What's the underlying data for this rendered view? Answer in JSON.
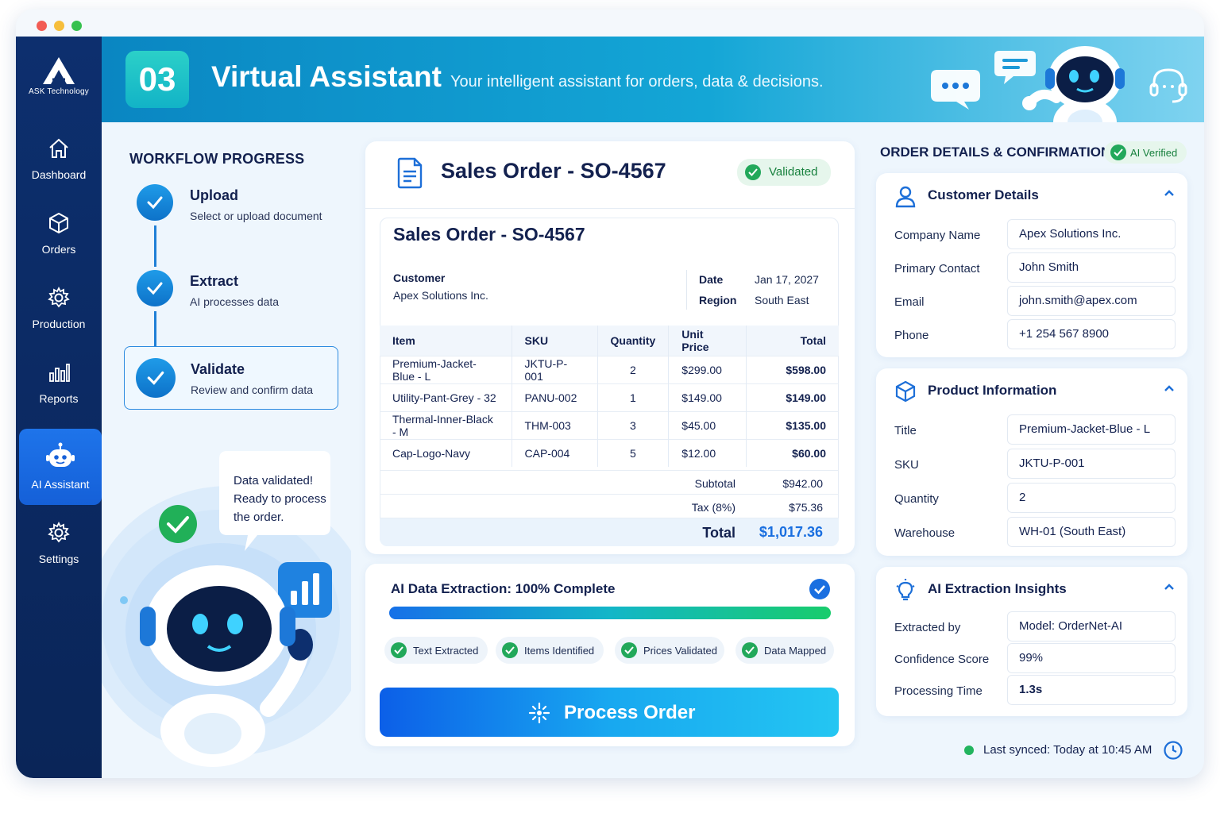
{
  "app": {
    "logo_text": "ASK Technology",
    "step_number": "03",
    "title": "Virtual Assistant",
    "subtitle": "Your intelligent assistant for orders, data & decisions."
  },
  "colors": {
    "primary": "#1560d8",
    "sidebar": "#0d2f6e",
    "success": "#22a85a",
    "accent": "#14a6d6"
  },
  "sidebar": {
    "items": [
      {
        "label": "Dashboard",
        "icon": "home-icon"
      },
      {
        "label": "Orders",
        "icon": "box-icon"
      },
      {
        "label": "Production",
        "icon": "gear-icon"
      },
      {
        "label": "Reports",
        "icon": "bar-chart-icon"
      },
      {
        "label": "AI Assistant",
        "icon": "robot-icon",
        "active": true
      },
      {
        "label": "Settings",
        "icon": "gear-icon"
      }
    ]
  },
  "workflow": {
    "title": "WORKFLOW PROGRESS",
    "steps": [
      {
        "title": "Upload",
        "subtitle": "Select or upload document"
      },
      {
        "title": "Extract",
        "subtitle": "AI processes data"
      },
      {
        "title": "Validate",
        "subtitle": "Review and confirm data"
      }
    ],
    "bubble": {
      "line1": "Data validated!",
      "line2": "Ready to process",
      "line3": "the order."
    }
  },
  "order": {
    "header_title": "Sales Order - SO-4567",
    "status": "Validated",
    "doc_title": "Sales Order - SO-4567",
    "customer_label": "Customer",
    "customer_value": "Apex Solutions Inc.",
    "date_label": "Date",
    "date_value": "Jan 17, 2027",
    "region_label": "Region",
    "region_value": "South East",
    "columns": [
      "Item",
      "SKU",
      "Quantity",
      "Unit Price",
      "Total"
    ],
    "rows": [
      [
        "Premium-Jacket-Blue - L",
        "JKTU-P-001",
        "2",
        "$299.00",
        "$598.00"
      ],
      [
        "Utility-Pant-Grey - 32",
        "PANU-002",
        "1",
        "$149.00",
        "$149.00"
      ],
      [
        "Thermal-Inner-Black - M",
        "THM-003",
        "3",
        "$45.00",
        "$135.00"
      ],
      [
        "Cap-Logo-Navy",
        "CAP-004",
        "5",
        "$12.00",
        "$60.00"
      ]
    ],
    "subtotal_label": "Subtotal",
    "subtotal_value": "$942.00",
    "tax_label": "Tax (8%)",
    "tax_value": "$75.36",
    "total_label": "Total",
    "total_value": "$1,017.36"
  },
  "extraction": {
    "title": "AI Data Extraction: 100% Complete",
    "progress": 1.0,
    "chips": [
      "Text Extracted",
      "Items Identified",
      "Prices Validated",
      "Data Mapped"
    ],
    "button_label": "Process Order"
  },
  "details": {
    "title": "ORDER DETAILS & CONFIRMATION",
    "badge": "AI Verified",
    "customer": {
      "title": "Customer Details",
      "fields": [
        {
          "label": "Company Name",
          "value": "Apex Solutions Inc."
        },
        {
          "label": "Primary Contact",
          "value": "John Smith"
        },
        {
          "label": "Email",
          "value": "john.smith@apex.com"
        },
        {
          "label": "Phone",
          "value": "+1 254 567 8900"
        }
      ]
    },
    "product": {
      "title": "Product Information",
      "fields": [
        {
          "label": "Title",
          "value": "Premium-Jacket-Blue - L"
        },
        {
          "label": "SKU",
          "value": "JKTU-P-001"
        },
        {
          "label": "Quantity",
          "value": "2"
        },
        {
          "label": "Warehouse",
          "value": "WH-01 (South East)"
        }
      ]
    },
    "insights": {
      "title": "AI Extraction Insights",
      "fields": [
        {
          "label": "Extracted by",
          "value": "Model: OrderNet-AI"
        },
        {
          "label": "Confidence Score",
          "value": "99%"
        },
        {
          "label": "Processing Time",
          "value": "1.3s"
        }
      ]
    }
  },
  "footer": {
    "sync": "Last synced: Today at 10:45 AM"
  }
}
